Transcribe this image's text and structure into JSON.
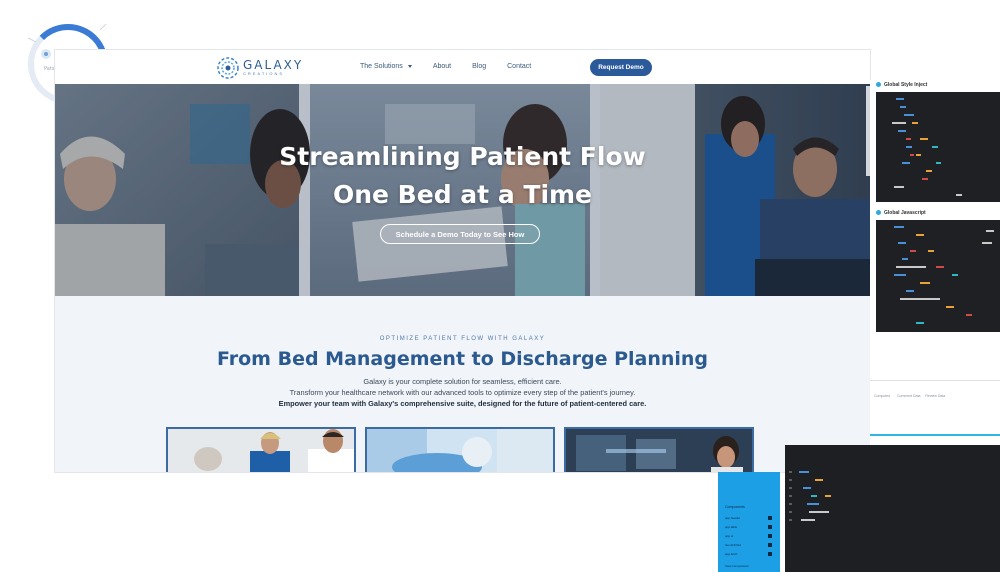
{
  "ring": {
    "label": "Pats",
    "accent": "#3a7bd5",
    "progress": 0.4
  },
  "nav": {
    "logo_name": "GALAXY",
    "logo_sub": "CREATIONS",
    "links": [
      "The Solutions",
      "About",
      "Blog",
      "Contact"
    ],
    "cta": "Request Demo"
  },
  "hero": {
    "title_line1": "Streamlining Patient Flow",
    "title_line2": "One Bed at a Time",
    "cta": "Schedule a Demo Today to See How"
  },
  "section": {
    "eyebrow": "OPTIMIZE PATIENT FLOW WITH GALAXY",
    "title": "From Bed Management to Discharge Planning",
    "p1": "Galaxy is your complete solution for seamless, efficient care.",
    "p2": "Transform your healthcare network with our advanced tools to optimize every step of the patient's journey.",
    "p3": "Empower your team with Galaxy's comprehensive suite, designed for the future of patient-centered care."
  },
  "right_panel": {
    "head1": "Global Style Inject",
    "head2": "Global Javascript",
    "tabs": [
      "Computed",
      "Comment Data",
      "Review Data"
    ]
  },
  "blue_panel": {
    "title": "Components",
    "rows": [
      "app.header",
      "app.table",
      "app.ui",
      "ItemsNOGA",
      "app.fetch"
    ],
    "footer": "View components"
  },
  "colors": {
    "brand": "#2b5a9b",
    "accent": "#1d9fe6",
    "code_bg": "#1f2023"
  }
}
